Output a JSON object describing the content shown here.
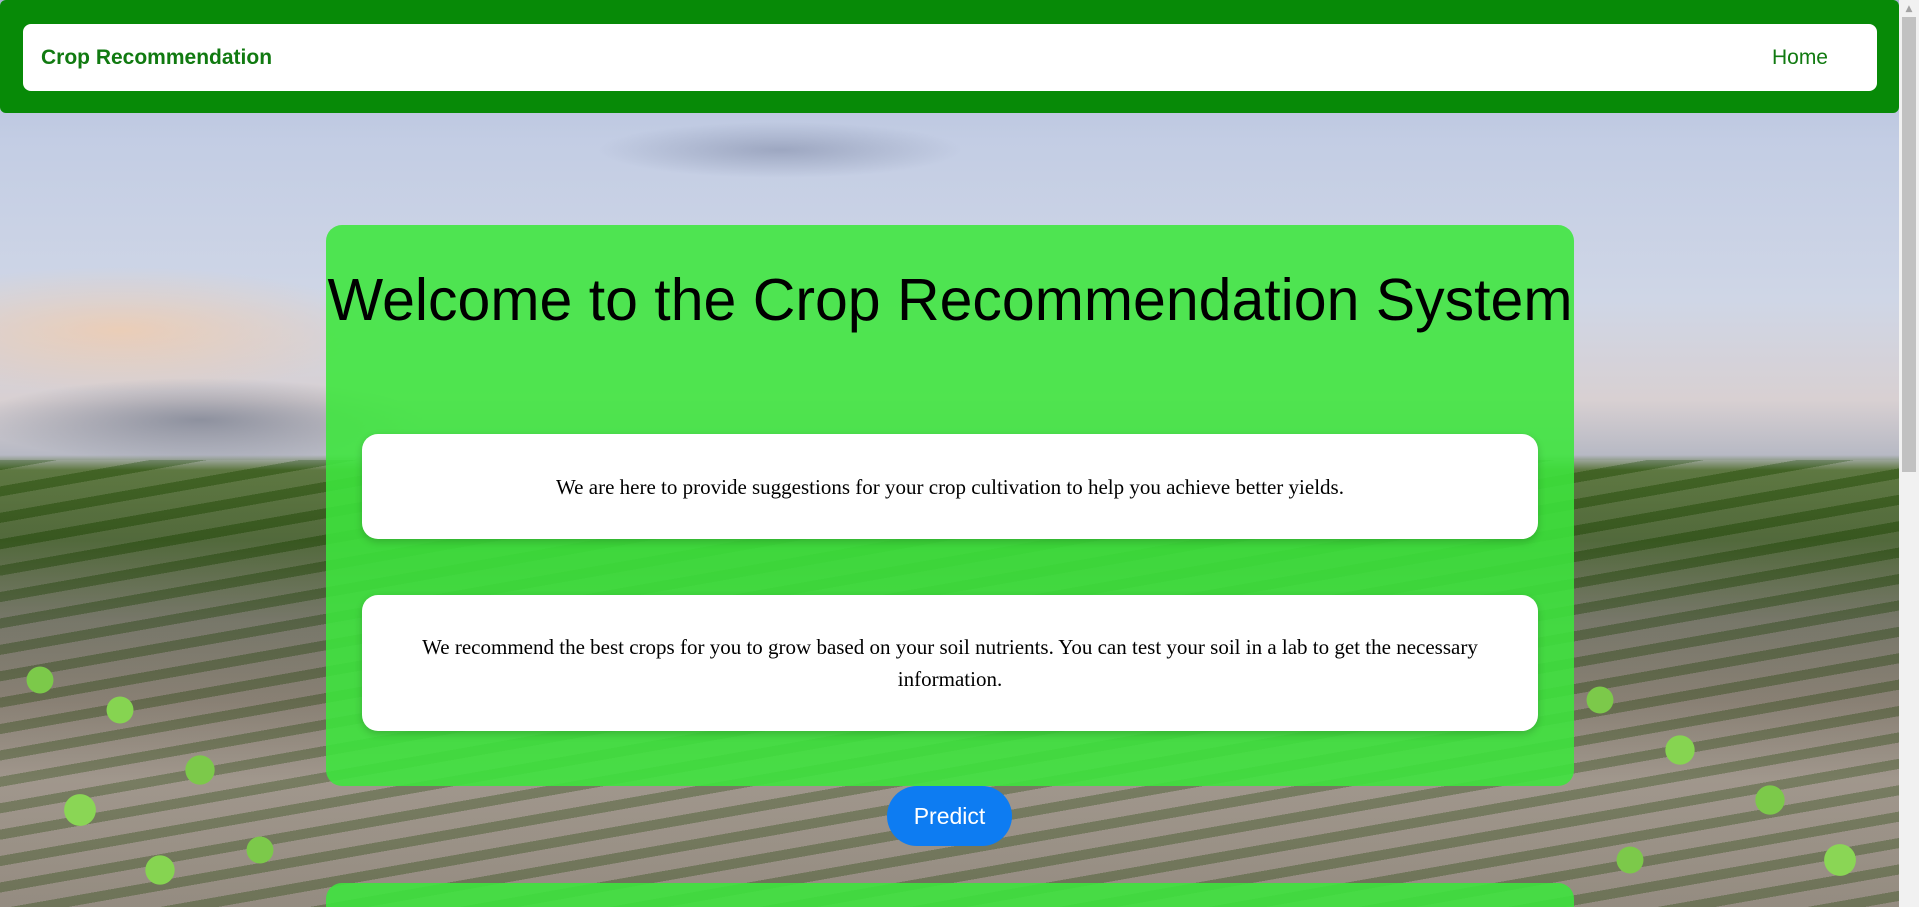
{
  "navbar": {
    "brand": "Crop Recommendation",
    "home_link": "Home"
  },
  "hero": {
    "title": "Welcome to the Crop Recommendation System",
    "card_1_text": "We are here to provide suggestions for your crop cultivation to help you achieve better yields.",
    "card_2_text": "We recommend the best crops for you to grow based on your soil nutrients. You can test your soil in a lab to get the necessary information.",
    "predict_button": "Predict"
  },
  "icons": {
    "scroll_up": "chevron-up-icon"
  },
  "colors": {
    "navbar_green": "#078a07",
    "link_green": "#117a11",
    "panel_green": "#3ce63c",
    "button_blue": "#0d7cf2"
  }
}
